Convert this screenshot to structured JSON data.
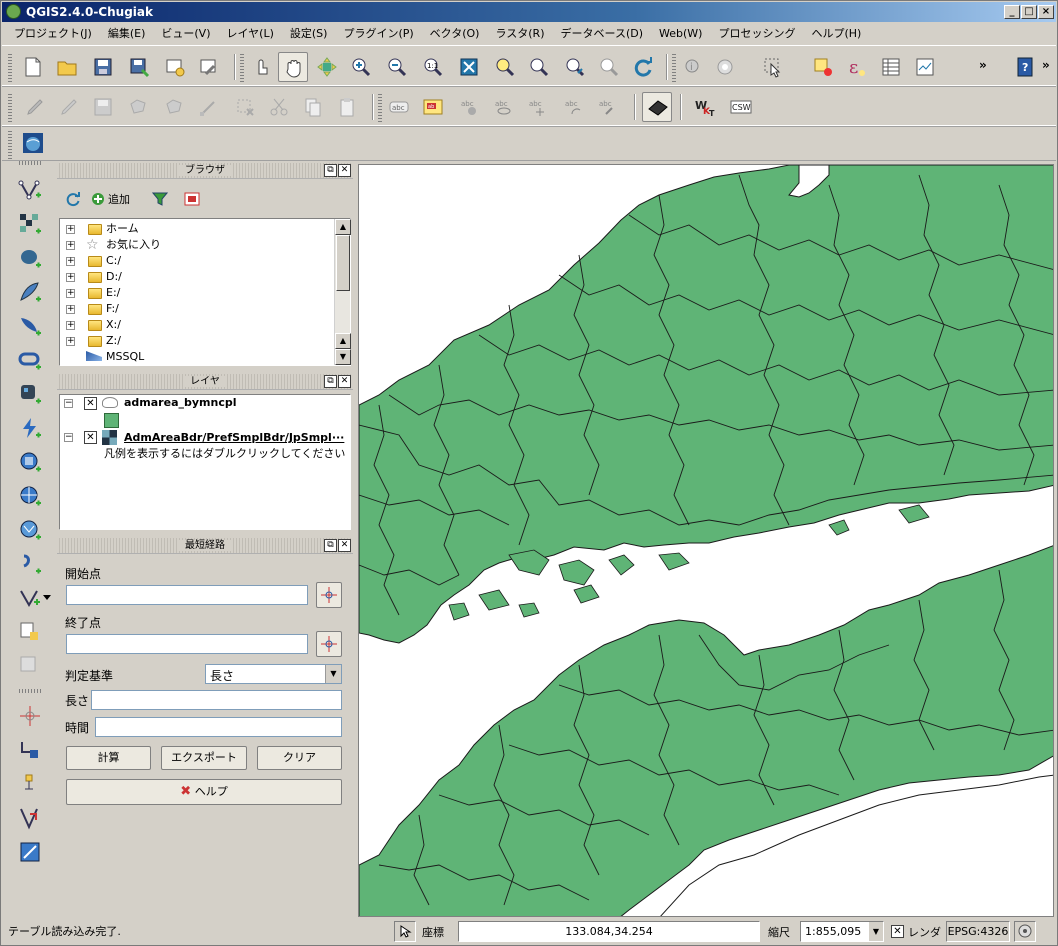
{
  "window": {
    "title": "QGIS2.4.0-Chugiak",
    "controls": {
      "minimize": "_",
      "maximize": "□",
      "close": "×"
    }
  },
  "menubar": [
    "プロジェクト(J)",
    "編集(E)",
    "ビュー(V)",
    "レイヤ(L)",
    "設定(S)",
    "プラグイン(P)",
    "ベクタ(O)",
    "ラスタ(R)",
    "データベース(D)",
    "Web(W)",
    "プロセッシング",
    "ヘルプ(H)"
  ],
  "toolbar": {
    "overflow": "»",
    "digitize_labels": {
      "abc": "abc",
      "wkt": "WKT",
      "csw": "CSW"
    }
  },
  "browser_panel": {
    "title": "ブラウザ",
    "add_label": "追加",
    "items": [
      "ホーム",
      "お気に入り",
      "C:/",
      "D:/",
      "E:/",
      "F:/",
      "X:/",
      "Z:/",
      "MSSQL"
    ]
  },
  "layers_panel": {
    "title": "レイヤ",
    "layers": [
      {
        "name": "admarea_bymncpl",
        "checked": true
      },
      {
        "name": "AdmAreaBdr/PrefSmplBdr/JpSmpl···",
        "checked": true,
        "note": "凡例を表示するにはダブルクリックしてください"
      }
    ]
  },
  "route_panel": {
    "title": "最短経路",
    "start_label": "開始点",
    "start_value": "",
    "end_label": "終了点",
    "end_value": "",
    "criterion_label": "判定基準",
    "criterion_value": "長さ",
    "length_label": "長さ",
    "length_value": "",
    "time_label": "時間",
    "time_value": "",
    "calc_button": "計算",
    "export_button": "エクスポート",
    "clear_button": "クリア",
    "help_button": "ヘルプ"
  },
  "map": {
    "land_color": "#5fb476",
    "sea_color": "#ffffff",
    "border_color": "#1a1a1a"
  },
  "statusbar": {
    "message": "テーブル読み込み完了.",
    "coord_label": "座標",
    "coord_value": "133.084,34.254",
    "scale_label": "縮尺",
    "scale_value": "1:855,095",
    "render_label": "レンダ",
    "render_checked": true,
    "crs": "EPSG:4326"
  }
}
